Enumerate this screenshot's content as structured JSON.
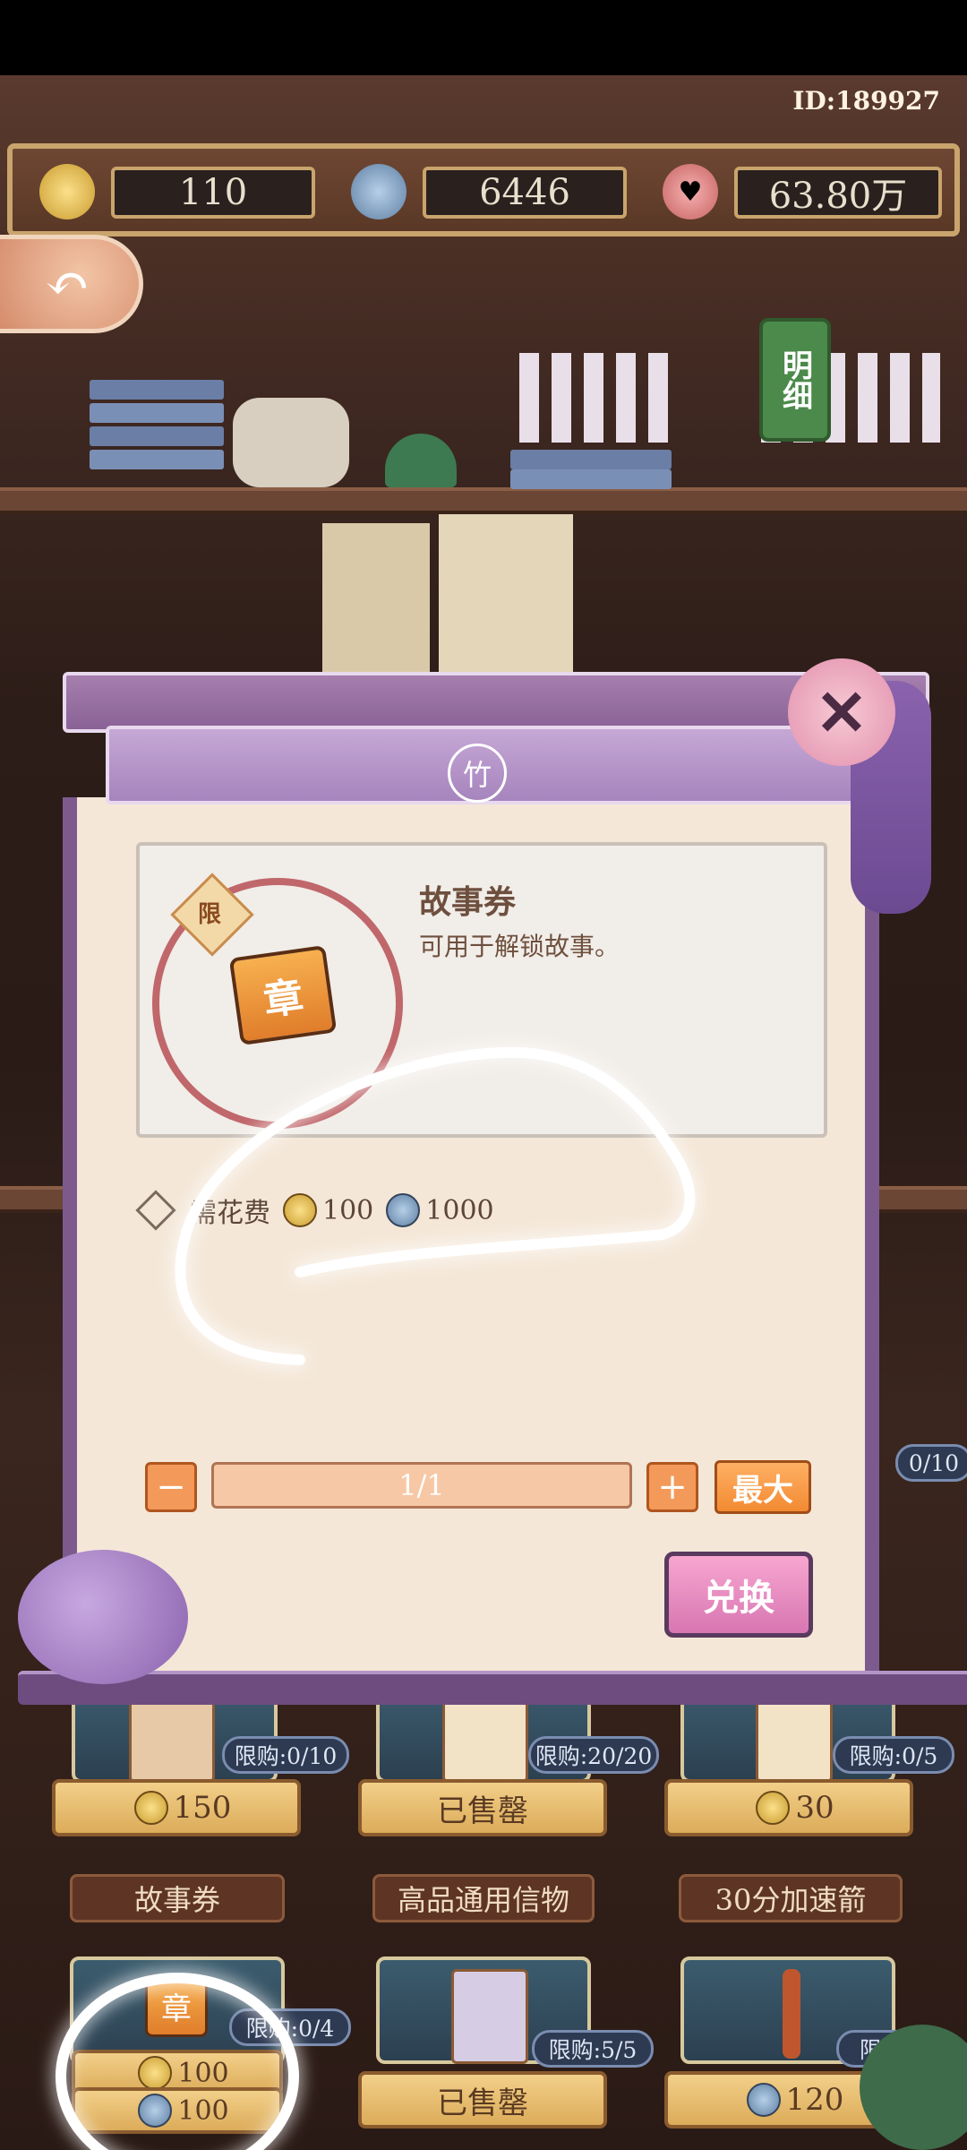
{
  "header": {
    "user_id": "ID:189927"
  },
  "currencies": [
    {
      "icon": "jade-coin-icon",
      "value": "110"
    },
    {
      "icon": "copper-coin-icon",
      "value": "6446"
    },
    {
      "icon": "heart-icon",
      "value": "63.80万"
    }
  ],
  "detail_tag": "明细",
  "modal": {
    "emblem": "竹",
    "item": {
      "limit_badge": "限",
      "icon_text": "章",
      "title": "故事券",
      "description": "可用于解锁故事。"
    },
    "cost": {
      "label": "需花费",
      "gold": "100",
      "blue": "1000"
    },
    "quantity": {
      "value": "1/1",
      "minus": "−",
      "plus": "+",
      "max_label": "最大"
    },
    "exchange_label": "兑换",
    "close_label": "✕"
  },
  "shop": {
    "side_counter": "0/10",
    "row1": [
      {
        "limit": "限购:0/10",
        "price": "150",
        "sold": false
      },
      {
        "limit": "限购:20/20",
        "price": "已售罄",
        "sold": true
      },
      {
        "limit": "限购:0/5",
        "price": "30",
        "sold": false
      }
    ],
    "row2_names": [
      "故事券",
      "高品通用信物",
      "30分加速箭"
    ],
    "row3": [
      {
        "limit": "限购:0/4",
        "price1": "100",
        "price2": "100",
        "icon_text": "章"
      },
      {
        "limit": "限购:5/5",
        "price": "已售罄"
      },
      {
        "limit": "限购:0",
        "price": "120"
      }
    ]
  }
}
